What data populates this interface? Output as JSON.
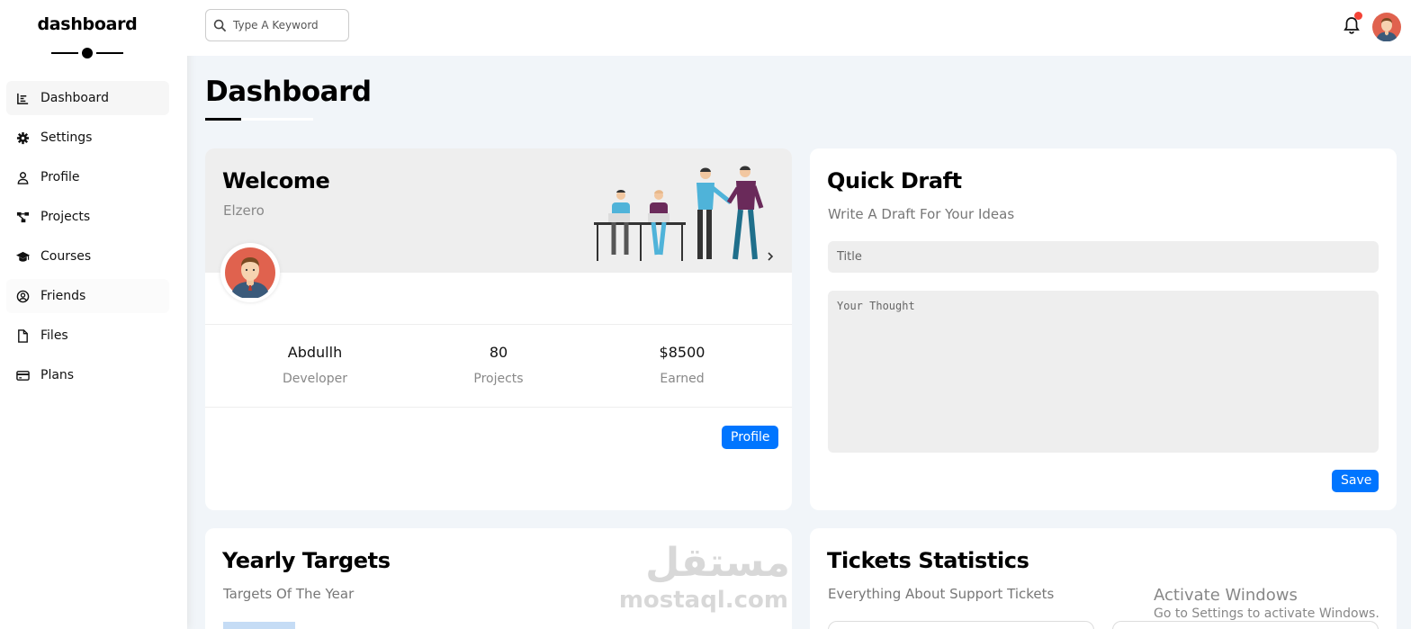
{
  "sidebar": {
    "brand": "dashboard",
    "items": [
      {
        "label": "Dashboard",
        "icon": "chart-icon"
      },
      {
        "label": "Settings",
        "icon": "gear-icon"
      },
      {
        "label": "Profile",
        "icon": "user-icon"
      },
      {
        "label": "Projects",
        "icon": "diagram-icon"
      },
      {
        "label": "Courses",
        "icon": "graduation-cap-icon"
      },
      {
        "label": "Friends",
        "icon": "user-circle-icon"
      },
      {
        "label": "Files",
        "icon": "file-icon"
      },
      {
        "label": "Plans",
        "icon": "credit-card-icon"
      }
    ]
  },
  "header": {
    "search_placeholder": "Type A Keyword"
  },
  "page": {
    "title": "Dashboard"
  },
  "welcome": {
    "title": "Welcome",
    "subtitle": "Elzero",
    "stats": [
      {
        "value": "Abdullh",
        "label": "Developer"
      },
      {
        "value": "80",
        "label": "Projects"
      },
      {
        "value": "$8500",
        "label": "Earned"
      }
    ],
    "button": "Profile"
  },
  "draft": {
    "title": "Quick Draft",
    "subtitle": "Write A Draft For Your Ideas",
    "title_placeholder": "Title",
    "thought_placeholder": "Your Thought",
    "button": "Save"
  },
  "targets": {
    "title": "Yearly Targets",
    "subtitle": "Targets Of The Year"
  },
  "tickets": {
    "title": "Tickets Statistics",
    "subtitle": "Everything About Support Tickets"
  },
  "watermark": {
    "arabic": "مستقل",
    "latin": "mostaql.com"
  },
  "os_overlay": {
    "line1": "Activate Windows",
    "line2": "Go to Settings to activate Windows."
  },
  "colors": {
    "accent": "#0075ff",
    "notification": "#f44336",
    "page_bg": "#f1f5f9"
  }
}
